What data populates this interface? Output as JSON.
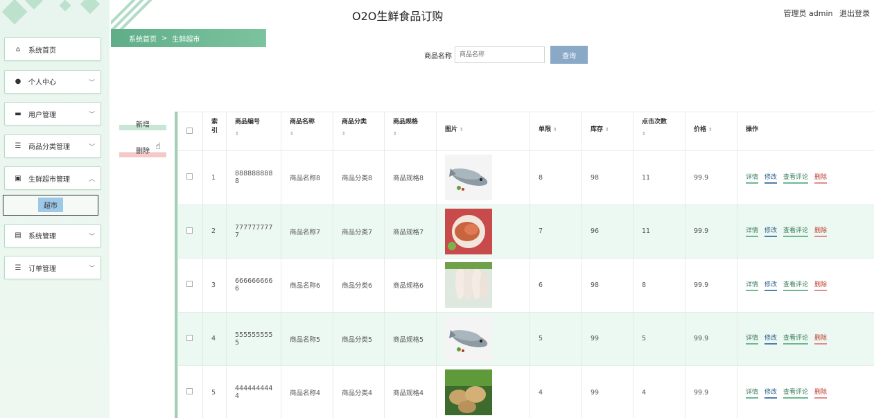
{
  "app": {
    "title": "O2O生鲜食品订购"
  },
  "user": {
    "role_name": "管理员 admin",
    "logout_label": "退出登录"
  },
  "breadcrumb": {
    "home": "系统首页",
    "separator": ">",
    "current": "生鲜超市"
  },
  "search": {
    "label": "商品名称",
    "placeholder": "商品名称",
    "value": "",
    "button_label": "查询"
  },
  "actions": {
    "add_label": "新增",
    "delete_label": "删除"
  },
  "sidebar": {
    "items": [
      {
        "label": "系统首页",
        "icon": "home-icon",
        "glyph": "⌂",
        "has_children": false
      },
      {
        "label": "个人中心",
        "icon": "user-icon",
        "glyph": "●",
        "has_children": true
      },
      {
        "label": "用户管理",
        "icon": "users-icon",
        "glyph": "▬",
        "has_children": true
      },
      {
        "label": "商品分类管理",
        "icon": "list-icon",
        "glyph": "☰",
        "has_children": true
      },
      {
        "label": "生鲜超市管理",
        "icon": "clipboard-icon",
        "glyph": "▣",
        "has_children": true,
        "expanded": true,
        "sub": "超市"
      },
      {
        "label": "系统管理",
        "icon": "settings-icon",
        "glyph": "▤",
        "has_children": true
      },
      {
        "label": "订单管理",
        "icon": "orders-icon",
        "glyph": "☰",
        "has_children": true
      }
    ]
  },
  "table": {
    "headers": {
      "index": "索引",
      "code": "商品编号",
      "name": "商品名称",
      "category": "商品分类",
      "spec": "商品规格",
      "image": "图片",
      "limit": "单限",
      "stock": "库存",
      "clicks": "点击次数",
      "price": "价格",
      "ops": "操作"
    },
    "op_labels": {
      "detail": "详情",
      "edit": "修改",
      "review": "查看评论",
      "delete": "删除"
    },
    "rows": [
      {
        "index": "1",
        "code": "8888888888",
        "name": "商品名称8",
        "category": "商品分类8",
        "spec": "商品规格8",
        "image": "fish",
        "limit": "8",
        "stock": "98",
        "clicks": "11",
        "price": "99.9"
      },
      {
        "index": "2",
        "code": "7777777777",
        "name": "商品名称7",
        "category": "商品分类7",
        "spec": "商品规格7",
        "image": "crab",
        "limit": "7",
        "stock": "96",
        "clicks": "11",
        "price": "99.9"
      },
      {
        "index": "3",
        "code": "6666666666",
        "name": "商品名称6",
        "category": "商品分类6",
        "spec": "商品规格6",
        "image": "chicken",
        "limit": "6",
        "stock": "98",
        "clicks": "8",
        "price": "99.9"
      },
      {
        "index": "4",
        "code": "5555555555",
        "name": "商品名称5",
        "category": "商品分类5",
        "spec": "商品规格5",
        "image": "fish",
        "limit": "5",
        "stock": "99",
        "clicks": "5",
        "price": "99.9"
      },
      {
        "index": "5",
        "code": "4444444444",
        "name": "商品名称4",
        "category": "商品分类4",
        "spec": "商品规格4",
        "image": "potato",
        "limit": "4",
        "stock": "99",
        "clicks": "4",
        "price": "99.9"
      }
    ]
  },
  "colors": {
    "accent": "#5fae88",
    "row_alt": "#ecf8f2",
    "delete": "#c0392b",
    "search_button": "#8aa9c7"
  }
}
